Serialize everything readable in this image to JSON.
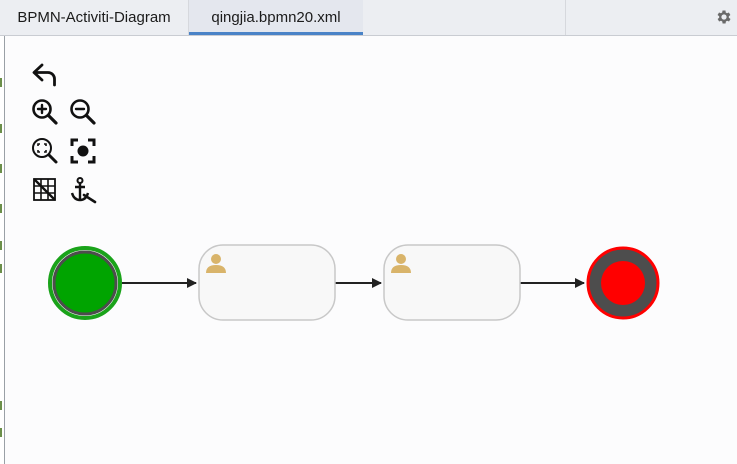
{
  "tabs": [
    {
      "label": "BPMN-Activiti-Diagram",
      "active": false
    },
    {
      "label": "qingjia.bpmn20.xml",
      "active": true
    }
  ],
  "toolbar_icons": [
    "undo-icon",
    "zoom-in-icon",
    "zoom-out-icon",
    "zoom-fit-icon",
    "center-view-icon",
    "grid-icon",
    "anchor-icon"
  ],
  "settings_icon": "gear-icon",
  "diagram": {
    "start_event": {
      "fill": "#00a400",
      "stroke": "#1aa31a"
    },
    "user_tasks": [
      {
        "icon": "user-icon",
        "label": ""
      },
      {
        "icon": "user-icon",
        "label": ""
      }
    ],
    "end_event": {
      "fill": "#ff0000",
      "stroke": "#ff0000",
      "ring": "#4d4d4d"
    },
    "colors": {
      "flow": "#222222",
      "task_fill": "#f8f8f8",
      "task_stroke": "#c8c8c8",
      "user_icon": "#d9b46a"
    }
  }
}
